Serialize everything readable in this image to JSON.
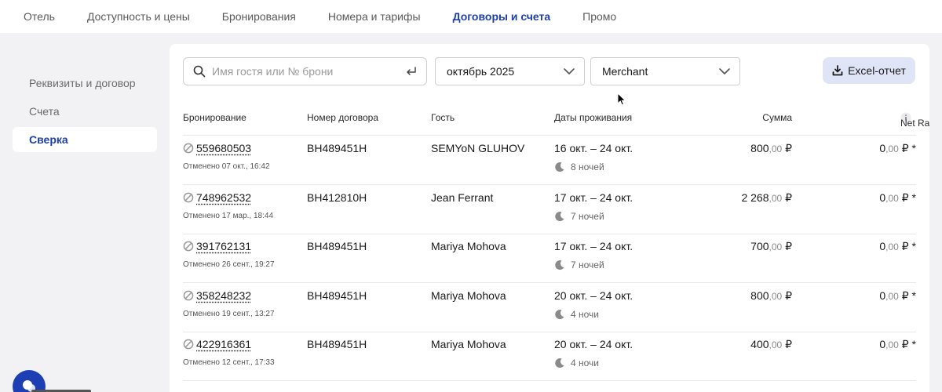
{
  "topnav": {
    "tabs": [
      {
        "label": "Отель"
      },
      {
        "label": "Доступность и цены"
      },
      {
        "label": "Бронирования"
      },
      {
        "label": "Номера и тарифы"
      },
      {
        "label": "Договоры и счета"
      },
      {
        "label": "Промо"
      }
    ],
    "active_index": 4
  },
  "sidebar": {
    "items": [
      {
        "label": "Реквизиты и договор"
      },
      {
        "label": "Счета"
      },
      {
        "label": "Сверка"
      }
    ],
    "active_index": 2
  },
  "filters": {
    "search_placeholder": "Имя гостя или № брони",
    "search_value": "",
    "month": "октябрь 2025",
    "payment_type": "Merchant",
    "export_label": "Excel-отчет"
  },
  "table": {
    "headers": {
      "booking": "Бронирование",
      "contract": "Номер договора",
      "guest": "Гость",
      "dates": "Даты проживания",
      "sum": "Сумма",
      "net_rate": "Net Rate (NR)"
    },
    "rows": [
      {
        "booking": "559680503",
        "cancel_note": "Отменено 07 окт., 16:42",
        "contract": "BH489451H",
        "guest": "SEMYoN GLUHOV",
        "dates": "16 окт. – 24 окт.",
        "nights": "8 ночей",
        "sum_int": "800",
        "sum_frac": ",00",
        "sum_cur": " ₽",
        "nr_int": "0",
        "nr_frac": ",00",
        "nr_cur": " ₽ *"
      },
      {
        "booking": "748962532",
        "cancel_note": "Отменено 17 мар., 18:44",
        "contract": "BH412810H",
        "guest": "Jean Ferrant",
        "dates": "17 окт. – 24 окт.",
        "nights": "7 ночей",
        "sum_int": "2 268",
        "sum_frac": ",00",
        "sum_cur": " ₽",
        "nr_int": "0",
        "nr_frac": ",00",
        "nr_cur": " ₽ *"
      },
      {
        "booking": "391762131",
        "cancel_note": "Отменено 26 сент., 19:27",
        "contract": "BH489451H",
        "guest": "Mariya Mohova",
        "dates": "17 окт. – 24 окт.",
        "nights": "7 ночей",
        "sum_int": "700",
        "sum_frac": ",00",
        "sum_cur": " ₽",
        "nr_int": "0",
        "nr_frac": ",00",
        "nr_cur": " ₽ *"
      },
      {
        "booking": "358248232",
        "cancel_note": "Отменено 19 сент., 13:27",
        "contract": "BH489451H",
        "guest": "Mariya Mohova",
        "dates": "20 окт. – 24 окт.",
        "nights": "4 ночи",
        "sum_int": "800",
        "sum_frac": ",00",
        "sum_cur": " ₽",
        "nr_int": "0",
        "nr_frac": ",00",
        "nr_cur": " ₽ *"
      },
      {
        "booking": "422916361",
        "cancel_note": "Отменено 12 сент., 17:33",
        "contract": "BH489451H",
        "guest": "Mariya Mohova",
        "dates": "20 окт. – 24 окт.",
        "nights": "4 ночи",
        "sum_int": "400",
        "sum_frac": ",00",
        "sum_cur": " ₽",
        "nr_int": "0",
        "nr_frac": ",00",
        "nr_cur": " ₽ *"
      }
    ]
  },
  "colors": {
    "accent": "#1f3fa8",
    "export_button_bg": "#dfe4f7",
    "chat_button": "#1e3fb3"
  },
  "icons": {
    "search": "search-icon",
    "enter": "enter-icon",
    "chevron": "chevron-down-icon",
    "download": "download-icon",
    "info": "info-icon",
    "cancelled": "cancelled-icon",
    "moon": "moon-icon"
  }
}
